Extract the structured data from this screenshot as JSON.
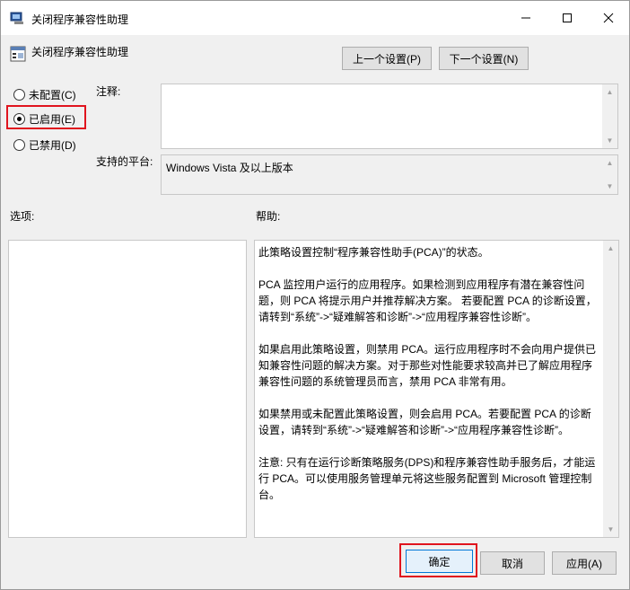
{
  "window": {
    "title": "关闭程序兼容性助理",
    "minimize_glyph": "—",
    "maximize_glyph": "☐",
    "close_glyph": "✕"
  },
  "header": {
    "policy_title": "关闭程序兼容性助理",
    "prev_button": "上一个设置(P)",
    "next_button": "下一个设置(N)"
  },
  "state": {
    "options": [
      {
        "label": "未配置(C)",
        "checked": false
      },
      {
        "label": "已启用(E)",
        "checked": true
      },
      {
        "label": "已禁用(D)",
        "checked": false
      }
    ],
    "highlight_color": "#e0141e"
  },
  "comment": {
    "label": "注释:",
    "value": ""
  },
  "platform": {
    "label": "支持的平台:",
    "value": "Windows Vista 及以上版本"
  },
  "options_section": {
    "label": "选项:"
  },
  "help_section": {
    "label": "帮助:",
    "paragraphs": [
      "此策略设置控制“程序兼容性助手(PCA)”的状态。",
      "PCA 监控用户运行的应用程序。如果检测到应用程序有潜在兼容性问题，则 PCA 将提示用户并推荐解决方案。 若要配置 PCA 的诊断设置，请转到“系统”->“疑难解答和诊断”->“应用程序兼容性诊断”。",
      "如果启用此策略设置，则禁用 PCA。运行应用程序时不会向用户提供已知兼容性问题的解决方案。对于那些对性能要求较高并已了解应用程序兼容性问题的系统管理员而言，禁用 PCA 非常有用。",
      "如果禁用或未配置此策略设置，则会启用 PCA。若要配置 PCA 的诊断设置，请转到“系统”->“疑难解答和诊断”->“应用程序兼容性诊断”。",
      "注意: 只有在运行诊断策略服务(DPS)和程序兼容性助手服务后，才能运行 PCA。可以使用服务管理单元将这些服务配置到 Microsoft 管理控制台。"
    ]
  },
  "footer": {
    "ok_button": "确定",
    "cancel_button": "取消",
    "apply_button": "应用(A)"
  }
}
